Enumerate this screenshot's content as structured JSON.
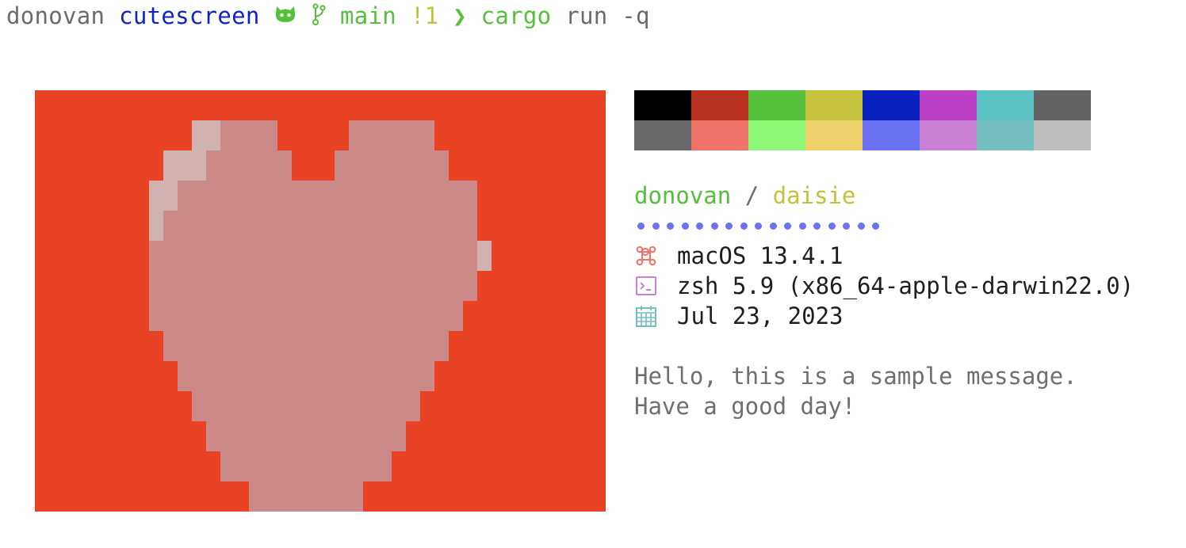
{
  "prompt": {
    "user": "donovan",
    "directory": "cutescreen",
    "repo_icon": "github-cat-icon",
    "branch_icon": "git-branch-icon",
    "branch": "main",
    "git_status": "!1",
    "chevron": "❯",
    "command": "cargo",
    "args": "run -q"
  },
  "palette": {
    "normal": [
      "#000000",
      "#b93220",
      "#55c03a",
      "#c6c43e",
      "#0a23c0",
      "#ba40c6",
      "#5cc3c4",
      "#636363"
    ],
    "bright": [
      "#686868",
      "#ee7368",
      "#8ef876",
      "#efcf6a",
      "#6b72f4",
      "#c87fd4",
      "#75bec0",
      "#bdbdbd"
    ]
  },
  "info": {
    "user": "donovan",
    "separator": "/",
    "host": "daisie",
    "dot_count": 17,
    "rows": [
      {
        "icon": "command-key-icon",
        "icon_color": "#ee7368",
        "text": "macOS 13.4.1"
      },
      {
        "icon": "terminal-icon",
        "icon_color": "#c87fd4",
        "text": "zsh 5.9 (x86_64-apple-darwin22.0)"
      },
      {
        "icon": "calendar-icon",
        "icon_color": "#75bec0",
        "text": "Jul 23, 2023"
      }
    ],
    "message_line1": "Hello, this is a sample message.",
    "message_line2": "Have a good day!"
  },
  "colors": {
    "heart_background": "#e94325",
    "heart_fill": "#cb8987",
    "heart_highlight": "#d1b2b1",
    "accent_green": "#55c03a",
    "accent_yellow": "#c2c23c",
    "accent_blue": "#1024c0",
    "dot_color": "#6b72f4"
  }
}
